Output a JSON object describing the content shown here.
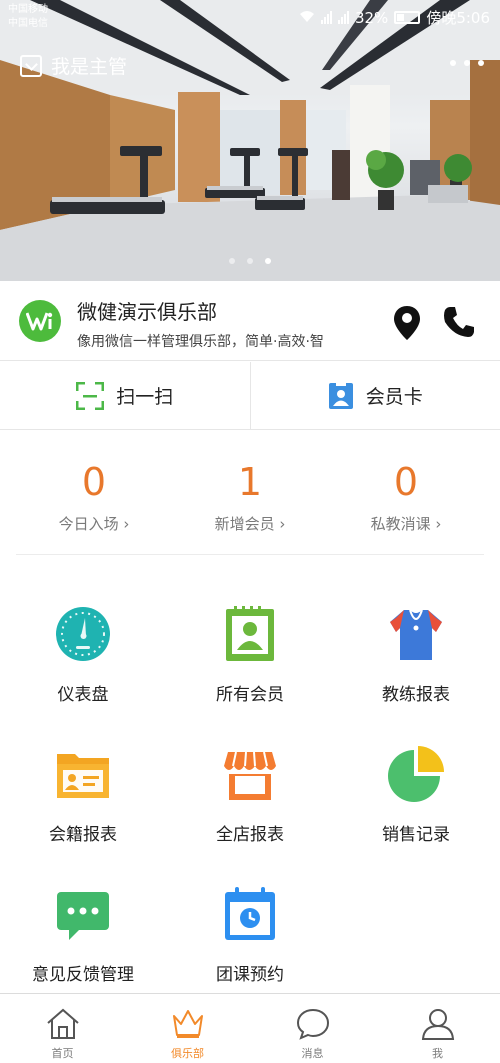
{
  "status_bar": {
    "carrier_1": "中国移动",
    "carrier_2": "中国电信",
    "battery": "32%",
    "time": "傍晚5:06"
  },
  "header": {
    "manager_label": "我是主管"
  },
  "carousel": {
    "slide_count": 3,
    "active_index": 2
  },
  "club": {
    "name": "微健演示俱乐部",
    "slogan": "像用微信一样管理俱乐部，简单·高效·智"
  },
  "quick_actions": [
    {
      "label": "扫一扫",
      "icon": "scan-icon"
    },
    {
      "label": "会员卡",
      "icon": "member-card-icon"
    }
  ],
  "stats": [
    {
      "value": "0",
      "label": "今日入场"
    },
    {
      "value": "1",
      "label": "新增会员"
    },
    {
      "value": "0",
      "label": "私教消课"
    }
  ],
  "features": [
    {
      "label": "仪表盘",
      "icon": "dashboard-icon"
    },
    {
      "label": "所有会员",
      "icon": "members-icon"
    },
    {
      "label": "教练报表",
      "icon": "coach-shirt-icon"
    },
    {
      "label": "会籍报表",
      "icon": "folder-card-icon"
    },
    {
      "label": "全店报表",
      "icon": "store-icon"
    },
    {
      "label": "销售记录",
      "icon": "pie-chart-icon"
    },
    {
      "label": "意见反馈管理",
      "icon": "chat-bubble-icon"
    },
    {
      "label": "团课预约",
      "icon": "calendar-icon"
    }
  ],
  "tabs": [
    {
      "label": "首页",
      "icon": "home-icon",
      "active": false
    },
    {
      "label": "俱乐部",
      "icon": "crown-icon",
      "active": true
    },
    {
      "label": "消息",
      "icon": "message-icon",
      "active": false
    },
    {
      "label": "我",
      "icon": "user-icon",
      "active": false
    }
  ],
  "colors": {
    "accent_orange": "#f28a2a",
    "stat_orange": "#e8782c",
    "logo_green": "#4dbb3c",
    "scan_green": "#4cb848",
    "card_blue": "#3b8fe0"
  }
}
